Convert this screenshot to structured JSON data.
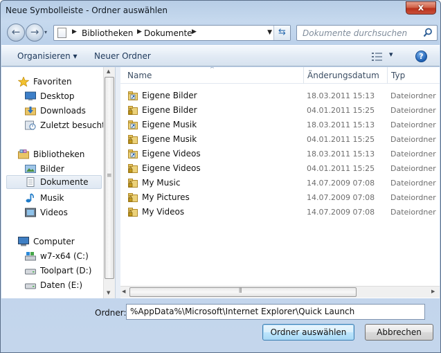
{
  "window": {
    "title": "Neue Symbolleiste - Ordner auswählen",
    "close_glyph": "x"
  },
  "nav": {
    "back_glyph": "←",
    "forward_glyph": "→",
    "history_glyph": "▾",
    "breadcrumbs": [
      "Bibliotheken",
      "Dokumente"
    ],
    "crumb_sep": "▶",
    "dropdown_glyph": "▼",
    "refresh_glyph": "⇆",
    "search_placeholder": "Dokumente durchsuchen"
  },
  "toolbar": {
    "organize_label": "Organisieren ▾",
    "new_folder_label": "Neuer Ordner",
    "view_dd_glyph": "▾",
    "help_glyph": "?"
  },
  "sidebar": {
    "favorites_label": "Favoriten",
    "favorites": [
      {
        "label": "Desktop",
        "icon": "desktop-icon"
      },
      {
        "label": "Downloads",
        "icon": "downloads-icon"
      },
      {
        "label": "Zuletzt besucht",
        "icon": "recent-places-icon"
      }
    ],
    "libraries_label": "Bibliotheken",
    "libraries": [
      {
        "label": "Bilder",
        "icon": "pictures-library-icon"
      },
      {
        "label": "Dokumente",
        "icon": "documents-library-icon",
        "selected": true
      },
      {
        "label": "Musik",
        "icon": "music-library-icon"
      },
      {
        "label": "Videos",
        "icon": "videos-library-icon"
      }
    ],
    "computer_label": "Computer",
    "drives": [
      {
        "label": "w7-x64 (C:)",
        "icon": "system-drive-icon"
      },
      {
        "label": "Toolpart (D:)",
        "icon": "drive-icon"
      },
      {
        "label": "Daten (E:)",
        "icon": "drive-icon"
      }
    ]
  },
  "columns": {
    "name": "Name",
    "modified": "Änderungsdatum",
    "type": "Typ"
  },
  "files": [
    {
      "name": "Eigene Bilder",
      "modified": "18.03.2011 15:13",
      "type": "Dateiordner",
      "icon": "shortcut-folder-icon"
    },
    {
      "name": "Eigene Bilder",
      "modified": "04.01.2011 15:25",
      "type": "Dateiordner",
      "icon": "locked-folder-icon"
    },
    {
      "name": "Eigene Musik",
      "modified": "18.03.2011 15:13",
      "type": "Dateiordner",
      "icon": "shortcut-folder-icon"
    },
    {
      "name": "Eigene Musik",
      "modified": "04.01.2011 15:25",
      "type": "Dateiordner",
      "icon": "locked-folder-icon"
    },
    {
      "name": "Eigene Videos",
      "modified": "18.03.2011 15:13",
      "type": "Dateiordner",
      "icon": "shortcut-folder-icon"
    },
    {
      "name": "Eigene Videos",
      "modified": "04.01.2011 15:25",
      "type": "Dateiordner",
      "icon": "locked-folder-icon"
    },
    {
      "name": "My Music",
      "modified": "14.07.2009 07:08",
      "type": "Dateiordner",
      "icon": "locked-folder-icon"
    },
    {
      "name": "My Pictures",
      "modified": "14.07.2009 07:08",
      "type": "Dateiordner",
      "icon": "locked-folder-icon"
    },
    {
      "name": "My Videos",
      "modified": "14.07.2009 07:08",
      "type": "Dateiordner",
      "icon": "locked-folder-icon"
    }
  ],
  "footer": {
    "folder_label": "Ordner:",
    "folder_value": "%AppData%\\Microsoft\\Internet Explorer\\Quick Launch",
    "select_button": "Ordner auswählen",
    "cancel_button": "Abbrechen"
  },
  "scrollbars": {
    "up_glyph": "▲",
    "down_glyph": "▼",
    "left_glyph": "◀",
    "right_glyph": "▶",
    "grip_glyph": "≡",
    "hgrip_glyph": "⦀"
  },
  "colors": {
    "title_bg": "#c6d9ee",
    "close_button": "#c9503a",
    "selection": "#dfe8f3",
    "accent": "#1d5fb3"
  }
}
